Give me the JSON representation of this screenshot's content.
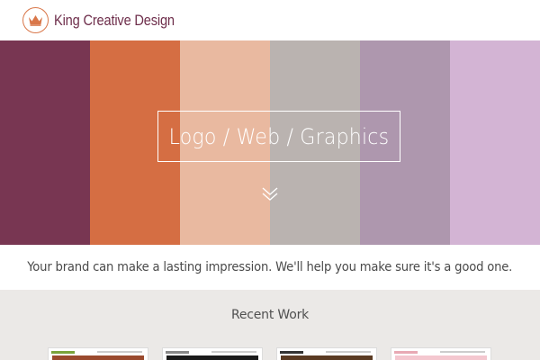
{
  "header": {
    "brand_name": "King Creative Design",
    "logo_icon": "crown-icon",
    "logo_color": "#d9774a",
    "brand_color": "#6e2e4b"
  },
  "hero": {
    "stripe_colors": [
      "#783652",
      "#d56e43",
      "#e9b9a0",
      "#bab3b0",
      "#ae97ae",
      "#d3b4d4"
    ],
    "title": "Logo / Web / Graphics",
    "scroll_icon": "chevron-double-down-icon"
  },
  "tagline": {
    "text": "Your brand can make a lasting impression. We'll help you make sure it's a good one."
  },
  "recent_work": {
    "title": "Recent Work",
    "background": "#ebe9e7",
    "thumbnails": [
      {
        "name": "portfolio-thumbnail-1",
        "accent": "#7aa33a",
        "image": "#9a4a2e"
      },
      {
        "name": "portfolio-thumbnail-2",
        "accent": "#888888",
        "image": "#1a1a1a"
      },
      {
        "name": "portfolio-thumbnail-3",
        "accent": "#333333",
        "image": "#5a3a22"
      },
      {
        "name": "portfolio-thumbnail-4",
        "accent": "#e8a9b4",
        "image": "#f4c7cf"
      }
    ]
  }
}
